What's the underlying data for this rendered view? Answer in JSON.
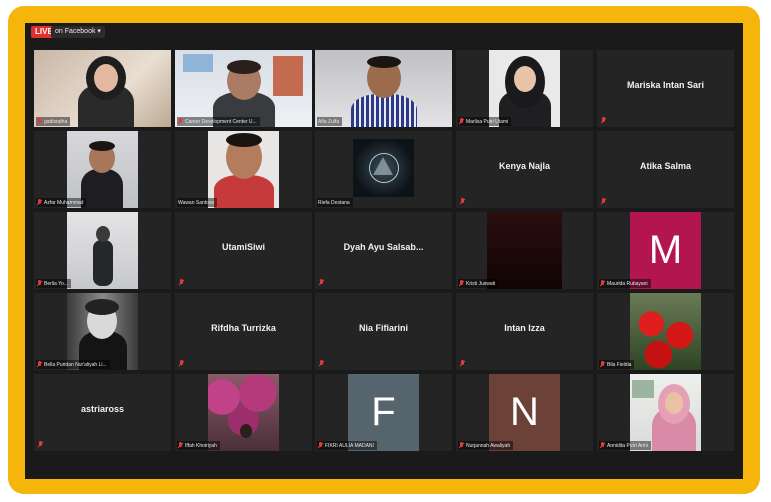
{
  "topbar": {
    "live_badge": "LIVE",
    "live_target": "on Facebook ▾"
  },
  "participants": [
    {
      "id": "gadisratha",
      "label": "gadisratha"
    },
    {
      "id": "career",
      "label": "Career Development Center U..."
    },
    {
      "id": "alfa",
      "label": "Alfa Zulfa"
    },
    {
      "id": "marlisa",
      "label": "Marlisa Putri Utami"
    },
    {
      "id": "mariska",
      "center": "Mariska Intan Sari"
    },
    {
      "id": "azfar",
      "label": "Azfar Muhammad"
    },
    {
      "id": "wawan",
      "label": "Wawan Santoso"
    },
    {
      "id": "riefa",
      "label": "Riefa Destana"
    },
    {
      "id": "kenya",
      "center": "Kenya Najla"
    },
    {
      "id": "atika",
      "center": "Atika Salma"
    },
    {
      "id": "berlia",
      "label": "Berlia Yo..."
    },
    {
      "id": "utami",
      "center": "UtamiSiwi"
    },
    {
      "id": "dyah",
      "center": "Dyah Ayu Salsab..."
    },
    {
      "id": "kristi",
      "label": "Kristi Juswati"
    },
    {
      "id": "maurida",
      "label": "Maurida Rubayani",
      "initial": "M",
      "color": "#b3164f"
    },
    {
      "id": "bella",
      "label": "Bella Puridan Nur'aliyah Li..."
    },
    {
      "id": "rifdha",
      "center": "Rifdha Turrizka"
    },
    {
      "id": "nia",
      "center": "Nia Fifiarini"
    },
    {
      "id": "intan",
      "center": "Intan Izza"
    },
    {
      "id": "bila",
      "label": "Bila Fieldia"
    },
    {
      "id": "astri",
      "center": "astriaross"
    },
    {
      "id": "iffah",
      "label": "Iffah Khoiriyah"
    },
    {
      "id": "fikri",
      "label": "FIKRI AULIA MADANI",
      "initial": "F",
      "color": "#56646d"
    },
    {
      "id": "nurjannah",
      "label": "Nurjannah Awaliyah",
      "initial": "N",
      "color": "#6b4138"
    },
    {
      "id": "annidita",
      "label": "Annidita Putri Arini"
    }
  ]
}
